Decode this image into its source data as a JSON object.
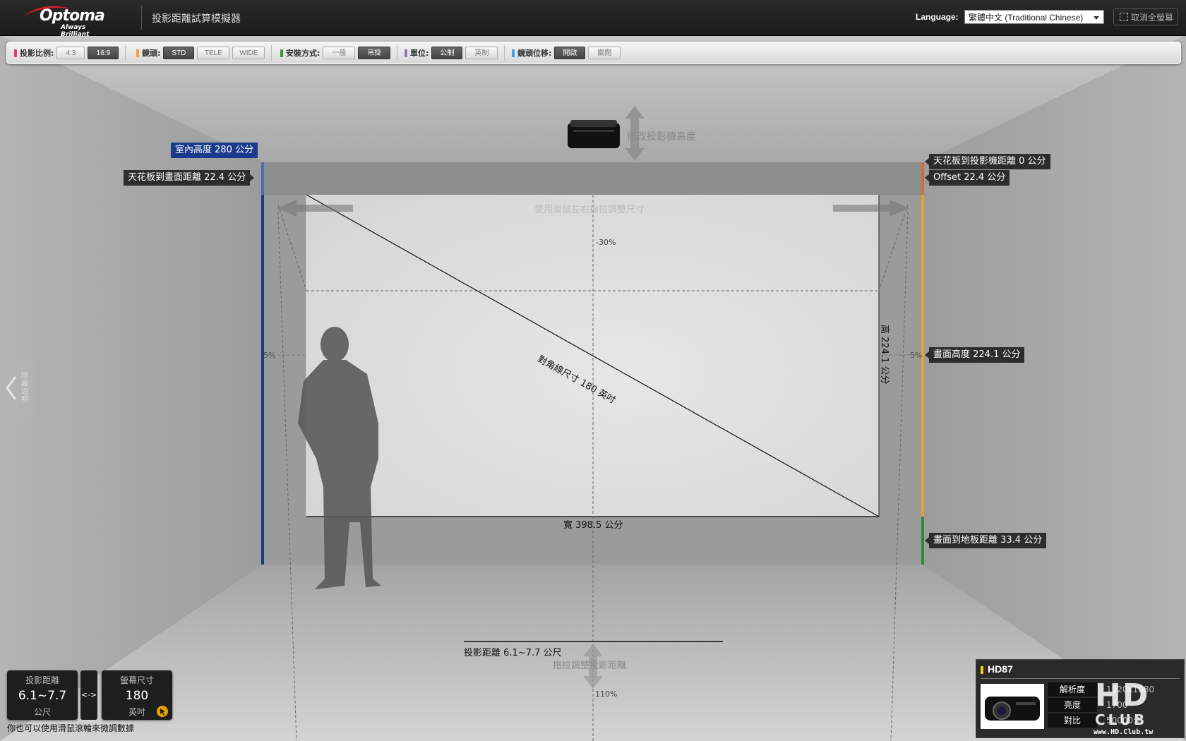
{
  "header": {
    "logo_text": "Optoma",
    "logo_tagline": "Always Brilliant",
    "app_title": "投影距離試算模擬器",
    "language_label": "Language:",
    "language_value": "繁體中文 (Traditional Chinese)",
    "fullscreen_label": "取消全螢幕"
  },
  "toolbar": {
    "aspect": {
      "label": "投影比例:",
      "color": "#e0407a",
      "options": [
        "4:3",
        "16:9"
      ],
      "selected": "16:9"
    },
    "lens": {
      "label": "鏡頭:",
      "color": "#f0a030",
      "options": [
        "STD",
        "TELE",
        "WIDE"
      ],
      "selected": "STD"
    },
    "mount": {
      "label": "安裝方式:",
      "color": "#3a9a40",
      "options": [
        "一般",
        "吊掛"
      ],
      "selected": "吊掛"
    },
    "unit": {
      "label": "單位:",
      "color": "#9a70c0",
      "options": [
        "公制",
        "英制"
      ],
      "selected": "公制"
    },
    "shift": {
      "label": "鏡頭位移:",
      "color": "#3aa0e0",
      "options": [
        "開啟",
        "關閉"
      ],
      "selected": "開啟"
    }
  },
  "room": {
    "room_height_label": "室內高度 280 公分",
    "ceiling_to_screen_label": "天花板到畫面距離 22.4 公分",
    "ceiling_to_projector_label": "天花板到投影機距離 0 公分",
    "offset_label": "Offset 22.4  公分",
    "screen_height_tag": "畫面高度 224.1 公分",
    "screen_to_floor_label": "畫面到地板距離 33.4 公分",
    "projector_height_hint": "修改投影機高度",
    "drag_resize_hint": "使用滑鼠左右拖拉調整尺寸",
    "shift_top_label": "-30%",
    "shift_left_label": "5%",
    "shift_right_label": "5%",
    "diagonal_label": "對角線尺寸 180 英吋",
    "screen_height_label": "高 224.1 公分",
    "screen_width_label": "寬 398.5 公分",
    "throw_distance_label": "投影距離 6.1~7.7 公尺",
    "drag_distance_hint": "拖拉調整投影距離",
    "throw_percent_label": "110%",
    "side_tab_label": "隱藏說明",
    "colors": {
      "room_height": "#1b3a8c",
      "ceiling_gap": "#4a6fb0",
      "offset": "#d07030",
      "screen": "#e8a030",
      "floor_gap": "#2f8a40"
    }
  },
  "readout": {
    "distance_label": "投影距離",
    "distance_value": "6.1~7.7",
    "distance_unit": "公尺",
    "swap_label": "<->",
    "size_label": "螢幕尺寸",
    "size_value": "180",
    "size_unit": "英吋",
    "hint": "你也可以使用滑鼠滾輪來微調數據"
  },
  "model": {
    "name": "HD87",
    "specs": [
      {
        "label": "解析度",
        "value": "1920x1080"
      },
      {
        "label": "亮度",
        "value": "1700"
      },
      {
        "label": "對比",
        "value": "50000:1"
      }
    ],
    "watermark_text": "HD",
    "watermark_sub": "CLUB",
    "watermark_url": "www.HD.Club.tw"
  }
}
